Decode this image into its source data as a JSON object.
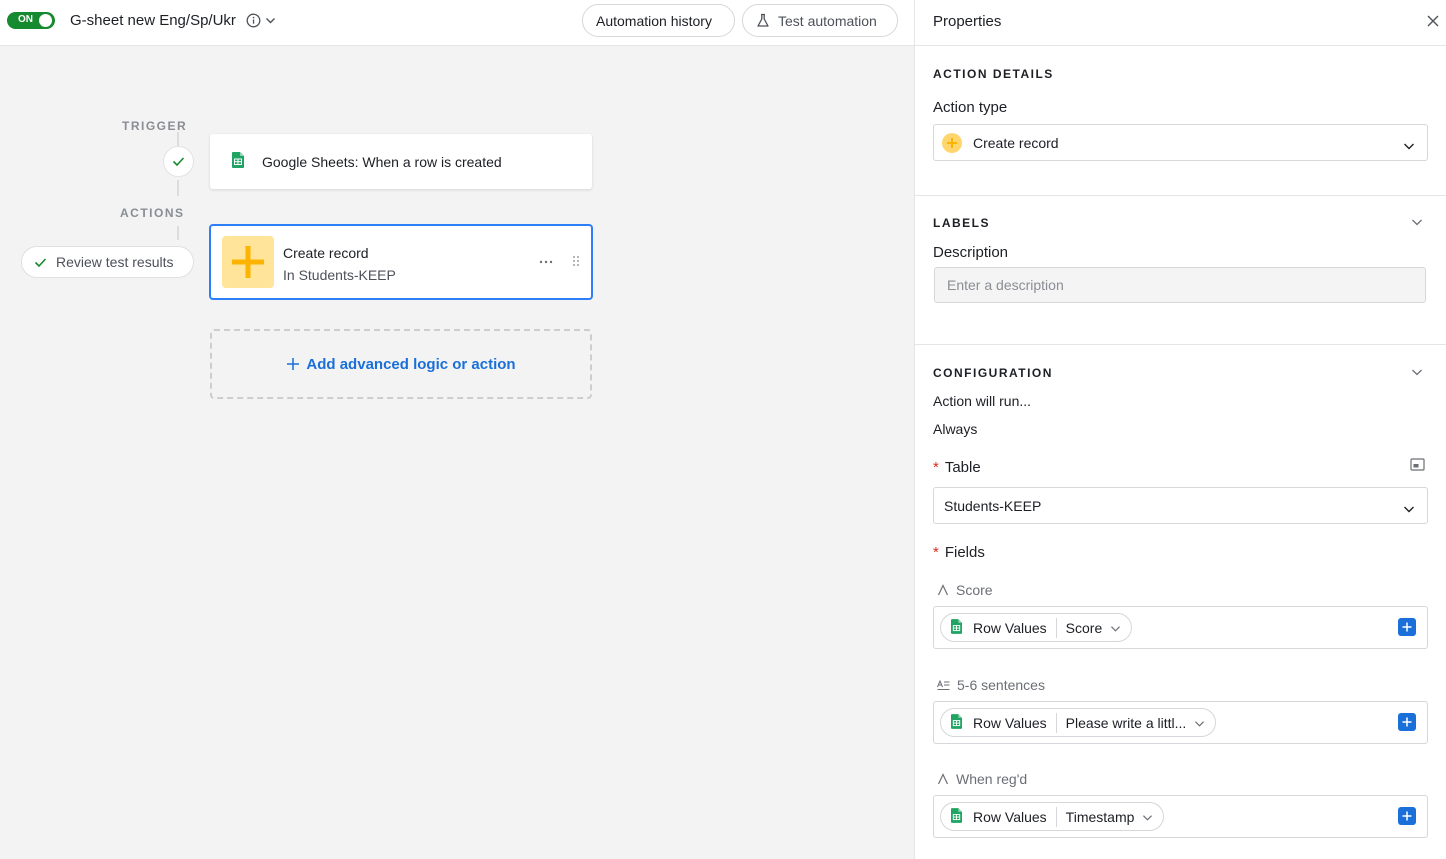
{
  "topbar": {
    "toggle_label": "ON",
    "title": "G-sheet new Eng/Sp/Ukr",
    "history_label": "Automation history",
    "test_label": "Test automation"
  },
  "canvas": {
    "trigger_label": "TRIGGER",
    "actions_label": "ACTIONS",
    "trigger_text": "Google Sheets: When a row is created",
    "review_label": "Review test results",
    "action_title": "Create record",
    "action_subtitle": "In Students-KEEP",
    "add_label": "Add advanced logic or action"
  },
  "panel": {
    "title": "Properties",
    "action_details": {
      "heading": "ACTION DETAILS",
      "action_type_label": "Action type",
      "action_type_value": "Create record"
    },
    "labels": {
      "heading": "LABELS",
      "description_label": "Description",
      "description_placeholder": "Enter a description"
    },
    "configuration": {
      "heading": "CONFIGURATION",
      "run_label": "Action will run...",
      "run_value": "Always",
      "table_label": "Table",
      "table_value": "Students-KEEP",
      "fields_label": "Fields",
      "fields": [
        {
          "name": "Score",
          "source": "Row Values",
          "value": "Score"
        },
        {
          "name": "5-6 sentences",
          "source": "Row Values",
          "value": "Please write a littl..."
        },
        {
          "name": "When reg'd",
          "source": "Row Values",
          "value": "Timestamp"
        }
      ]
    }
  },
  "colors": {
    "accent": "#2d7ff9",
    "toggle_on": "#168a2f",
    "link": "#1a6fd8",
    "required": "#d92d20"
  }
}
